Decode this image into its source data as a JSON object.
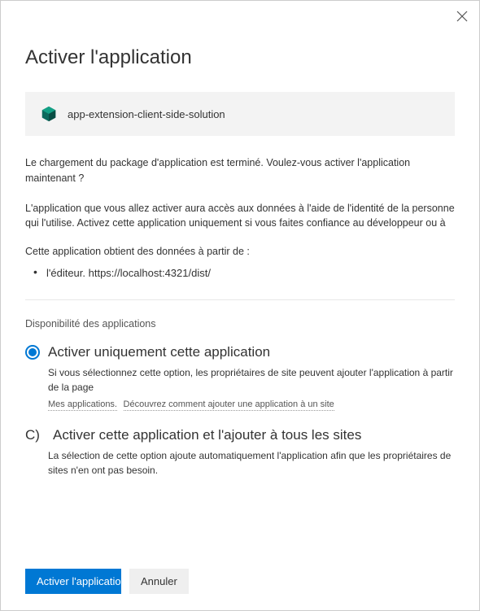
{
  "dialog": {
    "title": "Activer l'application",
    "app_name": "app-extension-client-side-solution",
    "intro_text": "Le chargement du package d'application est terminé. Voulez-vous activer l'application maintenant ?",
    "access_text": "L'application que vous allez activer aura accès aux données à l'aide de l'identité de la personne qui l'utilise. Activez cette application uniquement si vous faites confiance au développeur ou à",
    "data_source_label": "Cette application obtient des données à partir de :",
    "data_sources": [
      "l'éditeur. https://localhost:4321/dist/"
    ],
    "availability_label": "Disponibilité des applications",
    "options": [
      {
        "label": "Activer uniquement cette application",
        "desc": "Si vous sélectionnez cette option, les propriétaires de site peuvent ajouter l'application à partir de la page",
        "subdesc_a": "Mes applications.",
        "subdesc_b": "Découvrez comment ajouter une application à un site",
        "selected": true
      },
      {
        "prefix": "C)",
        "label": "Activer cette application et l'ajouter à tous les sites",
        "desc": "La sélection de cette option ajoute automatiquement l'application afin que les propriétaires de sites n'en ont pas besoin.",
        "selected": false
      }
    ],
    "primary_button": "Activer l'application",
    "cancel_button": "Annuler"
  }
}
